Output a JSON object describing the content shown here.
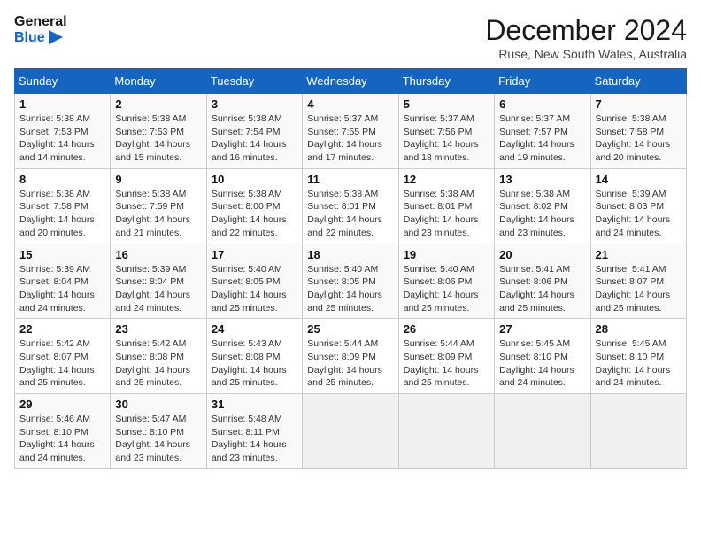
{
  "header": {
    "logo_line1": "General",
    "logo_line2": "Blue",
    "month": "December 2024",
    "location": "Ruse, New South Wales, Australia"
  },
  "weekdays": [
    "Sunday",
    "Monday",
    "Tuesday",
    "Wednesday",
    "Thursday",
    "Friday",
    "Saturday"
  ],
  "weeks": [
    [
      {
        "day": "1",
        "sunrise": "5:38 AM",
        "sunset": "7:53 PM",
        "daylight": "14 hours and 14 minutes."
      },
      {
        "day": "2",
        "sunrise": "5:38 AM",
        "sunset": "7:53 PM",
        "daylight": "14 hours and 15 minutes."
      },
      {
        "day": "3",
        "sunrise": "5:38 AM",
        "sunset": "7:54 PM",
        "daylight": "14 hours and 16 minutes."
      },
      {
        "day": "4",
        "sunrise": "5:37 AM",
        "sunset": "7:55 PM",
        "daylight": "14 hours and 17 minutes."
      },
      {
        "day": "5",
        "sunrise": "5:37 AM",
        "sunset": "7:56 PM",
        "daylight": "14 hours and 18 minutes."
      },
      {
        "day": "6",
        "sunrise": "5:37 AM",
        "sunset": "7:57 PM",
        "daylight": "14 hours and 19 minutes."
      },
      {
        "day": "7",
        "sunrise": "5:38 AM",
        "sunset": "7:58 PM",
        "daylight": "14 hours and 20 minutes."
      }
    ],
    [
      {
        "day": "8",
        "sunrise": "5:38 AM",
        "sunset": "7:58 PM",
        "daylight": "14 hours and 20 minutes."
      },
      {
        "day": "9",
        "sunrise": "5:38 AM",
        "sunset": "7:59 PM",
        "daylight": "14 hours and 21 minutes."
      },
      {
        "day": "10",
        "sunrise": "5:38 AM",
        "sunset": "8:00 PM",
        "daylight": "14 hours and 22 minutes."
      },
      {
        "day": "11",
        "sunrise": "5:38 AM",
        "sunset": "8:01 PM",
        "daylight": "14 hours and 22 minutes."
      },
      {
        "day": "12",
        "sunrise": "5:38 AM",
        "sunset": "8:01 PM",
        "daylight": "14 hours and 23 minutes."
      },
      {
        "day": "13",
        "sunrise": "5:38 AM",
        "sunset": "8:02 PM",
        "daylight": "14 hours and 23 minutes."
      },
      {
        "day": "14",
        "sunrise": "5:39 AM",
        "sunset": "8:03 PM",
        "daylight": "14 hours and 24 minutes."
      }
    ],
    [
      {
        "day": "15",
        "sunrise": "5:39 AM",
        "sunset": "8:04 PM",
        "daylight": "14 hours and 24 minutes."
      },
      {
        "day": "16",
        "sunrise": "5:39 AM",
        "sunset": "8:04 PM",
        "daylight": "14 hours and 24 minutes."
      },
      {
        "day": "17",
        "sunrise": "5:40 AM",
        "sunset": "8:05 PM",
        "daylight": "14 hours and 25 minutes."
      },
      {
        "day": "18",
        "sunrise": "5:40 AM",
        "sunset": "8:05 PM",
        "daylight": "14 hours and 25 minutes."
      },
      {
        "day": "19",
        "sunrise": "5:40 AM",
        "sunset": "8:06 PM",
        "daylight": "14 hours and 25 minutes."
      },
      {
        "day": "20",
        "sunrise": "5:41 AM",
        "sunset": "8:06 PM",
        "daylight": "14 hours and 25 minutes."
      },
      {
        "day": "21",
        "sunrise": "5:41 AM",
        "sunset": "8:07 PM",
        "daylight": "14 hours and 25 minutes."
      }
    ],
    [
      {
        "day": "22",
        "sunrise": "5:42 AM",
        "sunset": "8:07 PM",
        "daylight": "14 hours and 25 minutes."
      },
      {
        "day": "23",
        "sunrise": "5:42 AM",
        "sunset": "8:08 PM",
        "daylight": "14 hours and 25 minutes."
      },
      {
        "day": "24",
        "sunrise": "5:43 AM",
        "sunset": "8:08 PM",
        "daylight": "14 hours and 25 minutes."
      },
      {
        "day": "25",
        "sunrise": "5:44 AM",
        "sunset": "8:09 PM",
        "daylight": "14 hours and 25 minutes."
      },
      {
        "day": "26",
        "sunrise": "5:44 AM",
        "sunset": "8:09 PM",
        "daylight": "14 hours and 25 minutes."
      },
      {
        "day": "27",
        "sunrise": "5:45 AM",
        "sunset": "8:10 PM",
        "daylight": "14 hours and 24 minutes."
      },
      {
        "day": "28",
        "sunrise": "5:45 AM",
        "sunset": "8:10 PM",
        "daylight": "14 hours and 24 minutes."
      }
    ],
    [
      {
        "day": "29",
        "sunrise": "5:46 AM",
        "sunset": "8:10 PM",
        "daylight": "14 hours and 24 minutes."
      },
      {
        "day": "30",
        "sunrise": "5:47 AM",
        "sunset": "8:10 PM",
        "daylight": "14 hours and 23 minutes."
      },
      {
        "day": "31",
        "sunrise": "5:48 AM",
        "sunset": "8:11 PM",
        "daylight": "14 hours and 23 minutes."
      },
      null,
      null,
      null,
      null
    ]
  ]
}
